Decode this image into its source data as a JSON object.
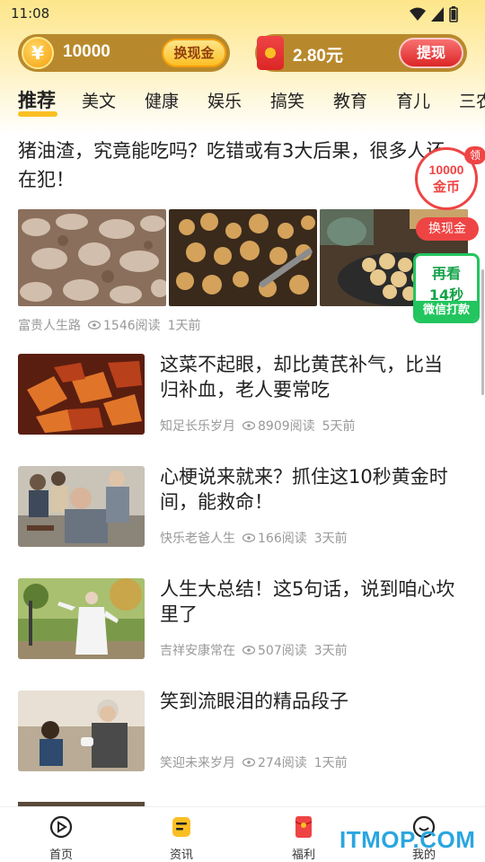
{
  "status_bar": {
    "time": "11:08"
  },
  "wallet": {
    "coins": "10000",
    "coin_symbol": "¥",
    "exchange_label": "换现金",
    "cash": "2.80元",
    "withdraw_label": "提现"
  },
  "tabs": [
    "推荐",
    "美文",
    "健康",
    "娱乐",
    "搞笑",
    "教育",
    "育儿",
    "三农"
  ],
  "active_tab": "推荐",
  "featured": {
    "title": "猪油渣，究竟能吃吗？吃错或有3大后果，很多人还在犯！",
    "author": "富贵人生路",
    "reads": "1546阅读",
    "time": "1天前"
  },
  "articles": [
    {
      "title": "这菜不起眼，却比黄芪补气，比当归补血，老人要常吃",
      "author": "知足长乐岁月",
      "reads": "8909阅读",
      "time": "5天前"
    },
    {
      "title": "心梗说来就来？抓住这10秒黄金时间，能救命！",
      "author": "快乐老爸人生",
      "reads": "166阅读",
      "time": "3天前"
    },
    {
      "title": "人生大总结！这5句话，说到咱心坎里了",
      "author": "吉祥安康常在",
      "reads": "507阅读",
      "time": "3天前"
    },
    {
      "title": "笑到流眼泪的精品段子",
      "author": "笑迎未来岁月",
      "reads": "274阅读",
      "time": "1天前"
    }
  ],
  "float_reward": {
    "badge": "领",
    "amount": "10000",
    "unit": "金币",
    "exchange": "换现金"
  },
  "float_wechat": {
    "line1": "再看",
    "line2": "14秒",
    "line3": "微信打款"
  },
  "bottom_nav": [
    {
      "label": "首页",
      "icon": "play-circle-icon"
    },
    {
      "label": "资讯",
      "icon": "news-icon"
    },
    {
      "label": "福利",
      "icon": "red-packet-icon"
    },
    {
      "label": "我的",
      "icon": "smile-icon"
    }
  ],
  "watermark": "ITMOP.COM",
  "colors": {
    "accent": "#fbbf24",
    "red": "#ef4444",
    "green": "#22c55e",
    "header_bg": "#fde68a"
  }
}
